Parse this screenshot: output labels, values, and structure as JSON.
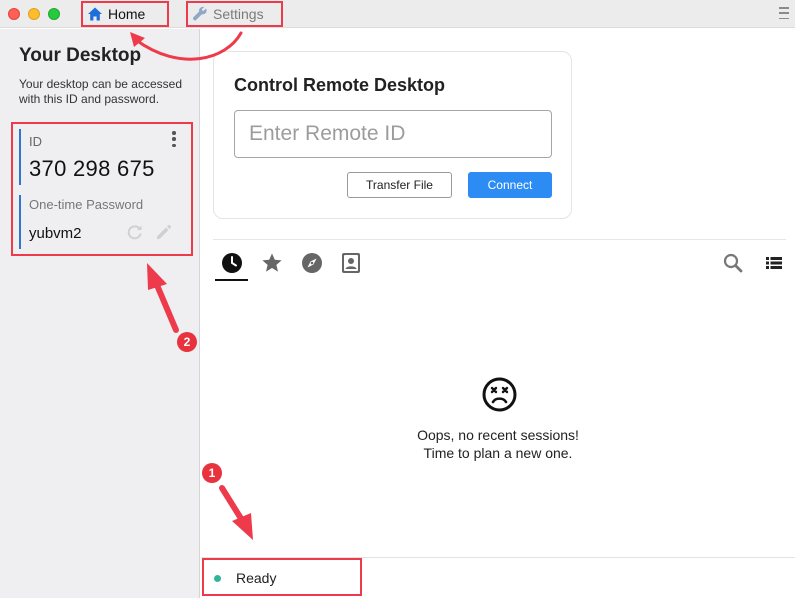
{
  "window": {
    "tabs": [
      {
        "label": "Home",
        "icon": "home-icon"
      },
      {
        "label": "Settings",
        "icon": "wrench-icon"
      }
    ]
  },
  "sidebar": {
    "title": "Your Desktop",
    "description": "Your desktop can be accessed with this ID and password.",
    "id_label": "ID",
    "id_value": "370 298 675",
    "password_label": "One-time Password",
    "password_value": "yubvm2"
  },
  "control": {
    "title": "Control Remote Desktop",
    "input_placeholder": "Enter Remote ID",
    "input_value": "",
    "transfer_label": "Transfer File",
    "connect_label": "Connect"
  },
  "session_tabs": [
    {
      "name": "recent",
      "icon": "clock-icon"
    },
    {
      "name": "favorites",
      "icon": "star-icon"
    },
    {
      "name": "discovered",
      "icon": "compass-icon"
    },
    {
      "name": "address-book",
      "icon": "contact-card-icon"
    }
  ],
  "empty_state": {
    "line1": "Oops, no recent sessions!",
    "line2": "Time to plan a new one."
  },
  "status": {
    "text": "Ready"
  },
  "annotations": [
    {
      "number": "1"
    },
    {
      "number": "2"
    }
  ],
  "colors": {
    "accent": "#2c8cf4",
    "highlight": "#ee3b4c",
    "status_ok": "#32b497"
  }
}
